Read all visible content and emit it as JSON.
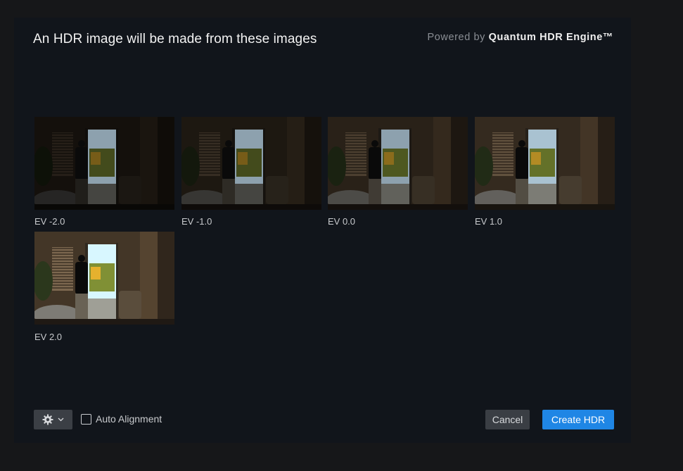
{
  "dialog": {
    "title": "An HDR image will be made from these images",
    "powered_prefix": "Powered by",
    "powered_brand": "Quantum HDR Engine™"
  },
  "images": [
    {
      "label": "EV -2.0",
      "brightness": 0.35
    },
    {
      "label": "EV -1.0",
      "brightness": 0.5
    },
    {
      "label": "EV 0.0",
      "brightness": 0.7
    },
    {
      "label": "EV 1.0",
      "brightness": 0.9
    },
    {
      "label": "EV 2.0",
      "brightness": 1.15
    }
  ],
  "footer": {
    "settings_icon": "gear-icon",
    "dropdown_icon": "chevron-down-icon",
    "auto_alignment_label": "Auto Alignment",
    "auto_alignment_checked": false,
    "cancel_label": "Cancel",
    "create_label": "Create HDR"
  },
  "colors": {
    "accent": "#1f86e5",
    "dialog_bg": "#11151b",
    "page_bg": "#161719"
  }
}
